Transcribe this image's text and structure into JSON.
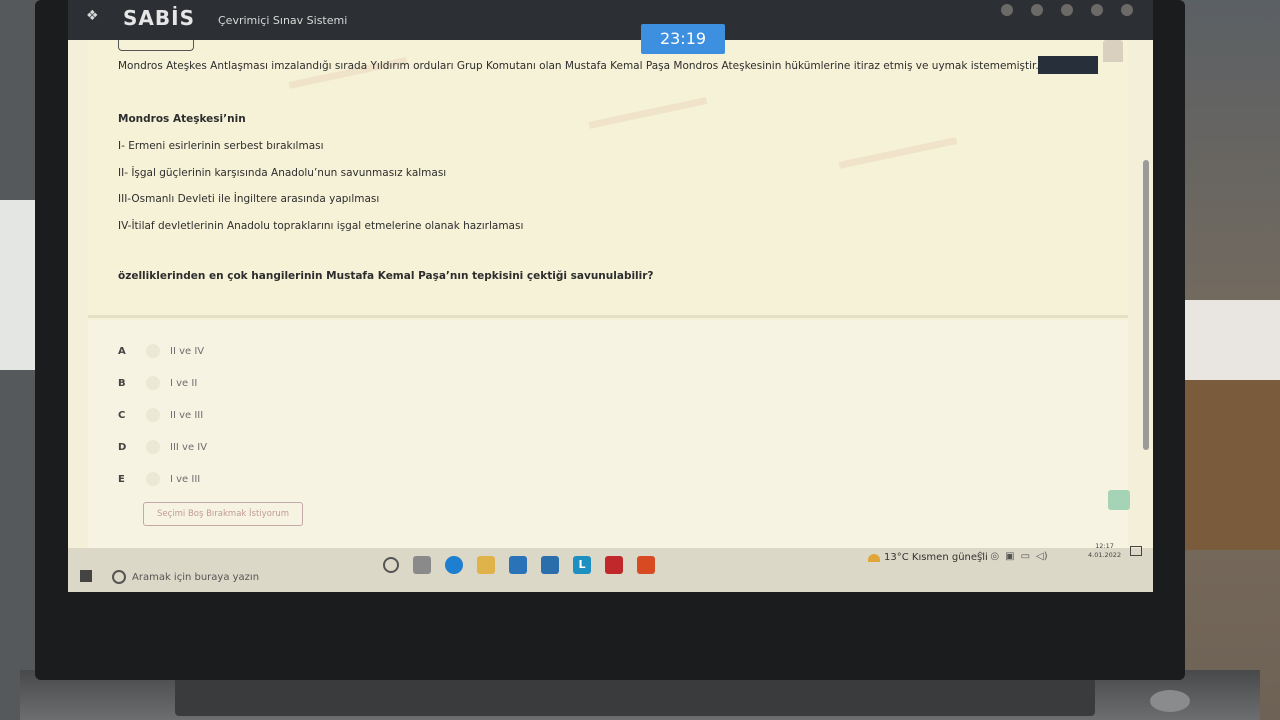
{
  "header": {
    "logo": "SABİS",
    "system_title": "Çevrimiçi Sınav Sistemi",
    "timer": "23:19"
  },
  "question": {
    "intro": "Mondros Ateşkes Antlaşması imzalandığı sırada Yıldırım orduları Grup Komutanı olan Mustafa Kemal Paşa Mondros Ateşkesinin hükümlerine itiraz etmiş ve uymak istememiştir.",
    "heading": "Mondros Ateşkesi’nin",
    "statements": [
      "I- Ermeni esirlerinin serbest bırakılması",
      "II- İşgal güçlerinin karşısında Anadolu’nun savunmasız kalması",
      "III-Osmanlı Devleti ile İngiltere arasında yapılması",
      "IV-İtilaf devletlerinin Anadolu topraklarını işgal etmelerine olanak hazırlaması"
    ],
    "prompt": "özelliklerinden en çok hangilerinin Mustafa Kemal Paşa’nın tepkisini çektiği savunulabilir?"
  },
  "options": [
    {
      "letter": "A",
      "text": "II ve IV"
    },
    {
      "letter": "B",
      "text": "I ve II"
    },
    {
      "letter": "C",
      "text": "II ve III"
    },
    {
      "letter": "D",
      "text": "III ve IV"
    },
    {
      "letter": "E",
      "text": "I ve III"
    }
  ],
  "clear_selection_label": "Seçimi Boş Bırakmak İstiyorum",
  "taskbar": {
    "search_placeholder": "Aramak için buraya yazın",
    "store_label": "L",
    "weather": "13°C  Kısmen güneşli",
    "time": "12:17",
    "date": "4.01.2022"
  },
  "colors": {
    "timer_bg": "#3d8fe0",
    "header_bg": "#2c2f33",
    "page_bg": "#f6f2d8"
  }
}
